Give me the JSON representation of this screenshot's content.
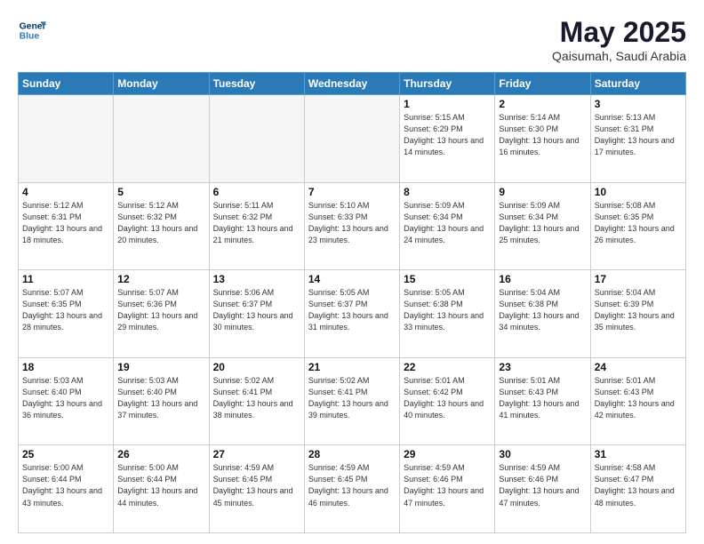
{
  "header": {
    "logo_line1": "General",
    "logo_line2": "Blue",
    "month": "May 2025",
    "location": "Qaisumah, Saudi Arabia"
  },
  "days_of_week": [
    "Sunday",
    "Monday",
    "Tuesday",
    "Wednesday",
    "Thursday",
    "Friday",
    "Saturday"
  ],
  "weeks": [
    [
      {
        "day": "",
        "info": ""
      },
      {
        "day": "",
        "info": ""
      },
      {
        "day": "",
        "info": ""
      },
      {
        "day": "",
        "info": ""
      },
      {
        "day": "1",
        "info": "Sunrise: 5:15 AM\nSunset: 6:29 PM\nDaylight: 13 hours\nand 14 minutes."
      },
      {
        "day": "2",
        "info": "Sunrise: 5:14 AM\nSunset: 6:30 PM\nDaylight: 13 hours\nand 16 minutes."
      },
      {
        "day": "3",
        "info": "Sunrise: 5:13 AM\nSunset: 6:31 PM\nDaylight: 13 hours\nand 17 minutes."
      }
    ],
    [
      {
        "day": "4",
        "info": "Sunrise: 5:12 AM\nSunset: 6:31 PM\nDaylight: 13 hours\nand 18 minutes."
      },
      {
        "day": "5",
        "info": "Sunrise: 5:12 AM\nSunset: 6:32 PM\nDaylight: 13 hours\nand 20 minutes."
      },
      {
        "day": "6",
        "info": "Sunrise: 5:11 AM\nSunset: 6:32 PM\nDaylight: 13 hours\nand 21 minutes."
      },
      {
        "day": "7",
        "info": "Sunrise: 5:10 AM\nSunset: 6:33 PM\nDaylight: 13 hours\nand 23 minutes."
      },
      {
        "day": "8",
        "info": "Sunrise: 5:09 AM\nSunset: 6:34 PM\nDaylight: 13 hours\nand 24 minutes."
      },
      {
        "day": "9",
        "info": "Sunrise: 5:09 AM\nSunset: 6:34 PM\nDaylight: 13 hours\nand 25 minutes."
      },
      {
        "day": "10",
        "info": "Sunrise: 5:08 AM\nSunset: 6:35 PM\nDaylight: 13 hours\nand 26 minutes."
      }
    ],
    [
      {
        "day": "11",
        "info": "Sunrise: 5:07 AM\nSunset: 6:35 PM\nDaylight: 13 hours\nand 28 minutes."
      },
      {
        "day": "12",
        "info": "Sunrise: 5:07 AM\nSunset: 6:36 PM\nDaylight: 13 hours\nand 29 minutes."
      },
      {
        "day": "13",
        "info": "Sunrise: 5:06 AM\nSunset: 6:37 PM\nDaylight: 13 hours\nand 30 minutes."
      },
      {
        "day": "14",
        "info": "Sunrise: 5:05 AM\nSunset: 6:37 PM\nDaylight: 13 hours\nand 31 minutes."
      },
      {
        "day": "15",
        "info": "Sunrise: 5:05 AM\nSunset: 6:38 PM\nDaylight: 13 hours\nand 33 minutes."
      },
      {
        "day": "16",
        "info": "Sunrise: 5:04 AM\nSunset: 6:38 PM\nDaylight: 13 hours\nand 34 minutes."
      },
      {
        "day": "17",
        "info": "Sunrise: 5:04 AM\nSunset: 6:39 PM\nDaylight: 13 hours\nand 35 minutes."
      }
    ],
    [
      {
        "day": "18",
        "info": "Sunrise: 5:03 AM\nSunset: 6:40 PM\nDaylight: 13 hours\nand 36 minutes."
      },
      {
        "day": "19",
        "info": "Sunrise: 5:03 AM\nSunset: 6:40 PM\nDaylight: 13 hours\nand 37 minutes."
      },
      {
        "day": "20",
        "info": "Sunrise: 5:02 AM\nSunset: 6:41 PM\nDaylight: 13 hours\nand 38 minutes."
      },
      {
        "day": "21",
        "info": "Sunrise: 5:02 AM\nSunset: 6:41 PM\nDaylight: 13 hours\nand 39 minutes."
      },
      {
        "day": "22",
        "info": "Sunrise: 5:01 AM\nSunset: 6:42 PM\nDaylight: 13 hours\nand 40 minutes."
      },
      {
        "day": "23",
        "info": "Sunrise: 5:01 AM\nSunset: 6:43 PM\nDaylight: 13 hours\nand 41 minutes."
      },
      {
        "day": "24",
        "info": "Sunrise: 5:01 AM\nSunset: 6:43 PM\nDaylight: 13 hours\nand 42 minutes."
      }
    ],
    [
      {
        "day": "25",
        "info": "Sunrise: 5:00 AM\nSunset: 6:44 PM\nDaylight: 13 hours\nand 43 minutes."
      },
      {
        "day": "26",
        "info": "Sunrise: 5:00 AM\nSunset: 6:44 PM\nDaylight: 13 hours\nand 44 minutes."
      },
      {
        "day": "27",
        "info": "Sunrise: 4:59 AM\nSunset: 6:45 PM\nDaylight: 13 hours\nand 45 minutes."
      },
      {
        "day": "28",
        "info": "Sunrise: 4:59 AM\nSunset: 6:45 PM\nDaylight: 13 hours\nand 46 minutes."
      },
      {
        "day": "29",
        "info": "Sunrise: 4:59 AM\nSunset: 6:46 PM\nDaylight: 13 hours\nand 47 minutes."
      },
      {
        "day": "30",
        "info": "Sunrise: 4:59 AM\nSunset: 6:46 PM\nDaylight: 13 hours\nand 47 minutes."
      },
      {
        "day": "31",
        "info": "Sunrise: 4:58 AM\nSunset: 6:47 PM\nDaylight: 13 hours\nand 48 minutes."
      }
    ]
  ]
}
